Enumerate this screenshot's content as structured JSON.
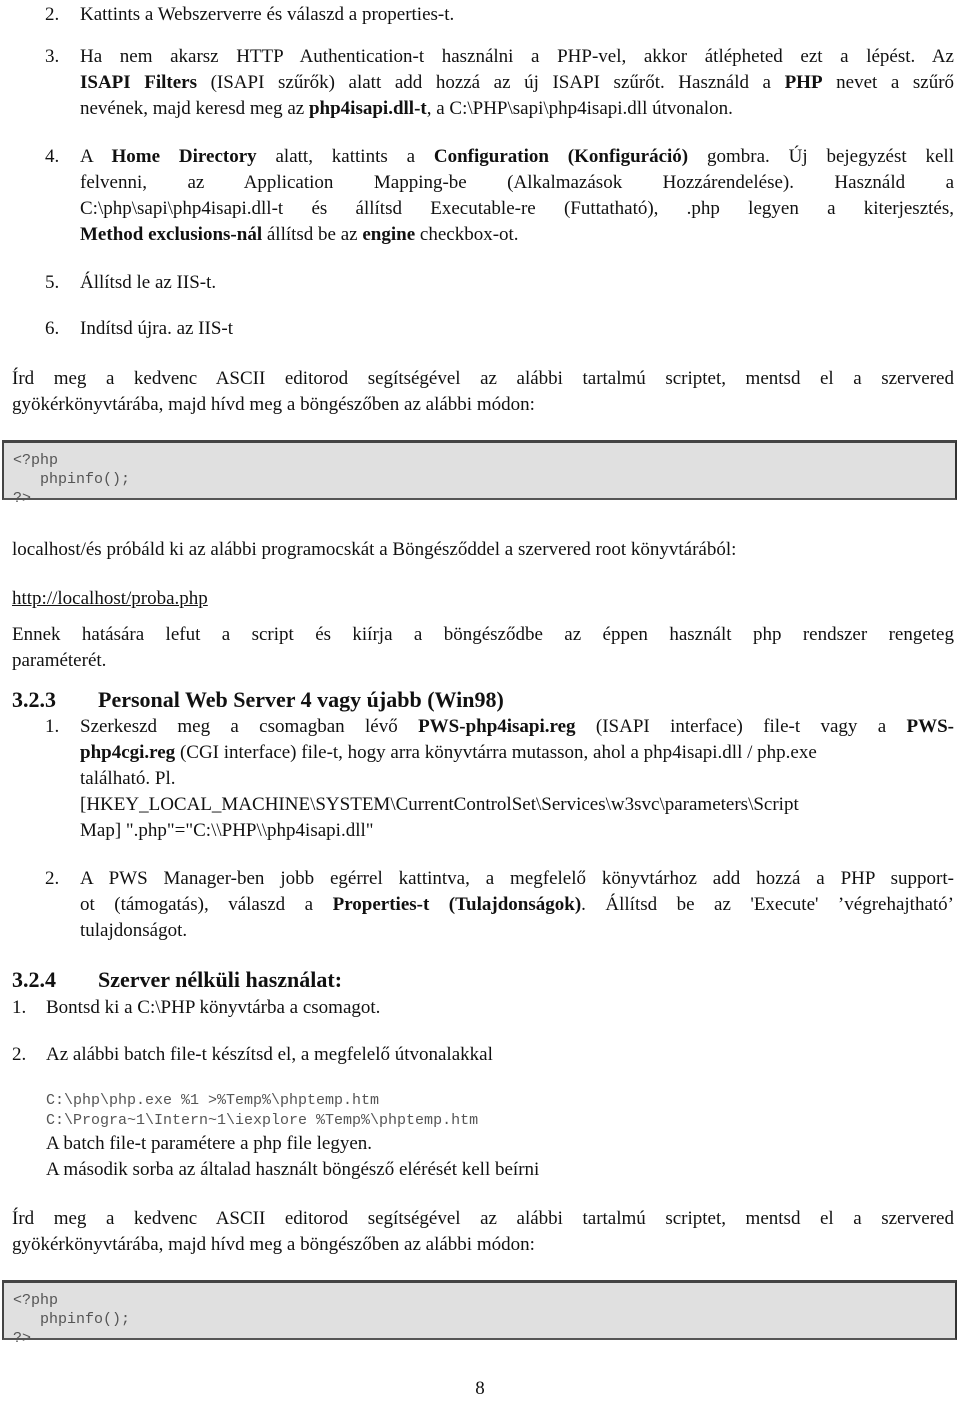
{
  "iis_steps": [
    {
      "num": "2.",
      "text": "Kattints a Webszerverre és válaszd a properties-t."
    },
    {
      "num": "3.",
      "lines": [
        "Ha nem akarsz HTTP Authentication-t használni a PHP-vel, akkor átléphet ezt a lépést. Az",
        "",
        ""
      ],
      "l1": "Ha nem akarsz HTTP Authentication-t használni a PHP-vel, akkor átlépheted ezt a lépést. Az",
      "l2_b1": "ISAPI Filters",
      "l2_t1": " (ISAPI szűrők) alatt add hozzá az új ISAPI szűrőt. Használd a ",
      "l2_b2": "PHP",
      "l2_t2": " nevet a szűrő",
      "l3_t1": "nevének, majd keresd meg az ",
      "l3_b1": "php4isapi.dll-t",
      "l3_t2": ", a C:\\PHP\\sapi\\php4isapi.dll útvonalon."
    },
    {
      "num": "4.",
      "l1_t1": "A ",
      "l1_b1": "Home Directory",
      "l1_t2": " alatt, kattints a ",
      "l1_b2": "Configuration (Konfiguráció)",
      "l1_t3": " gombra. Új bejegyzést kell",
      "l2": "felvenni, az Application Mapping-be (Alkalmazások Hozzárendelése). Használd a",
      "l3": "C:\\php\\sapi\\php4isapi.dll-t és állítsd Executable-re (Futtatható), .php legyen a kiterjesztés,",
      "l4_b1": "Method exclusions-nál",
      "l4_t1": " állítsd be az ",
      "l4_b2": "engine",
      "l4_t2": " checkbox-ot."
    },
    {
      "num": "5.",
      "text": "Állítsd le az IIS-t."
    },
    {
      "num": "6.",
      "text": "Indítsd újra. az IIS-t"
    }
  ],
  "intro1": {
    "l1": "Írd meg a kedvenc ASCII editorod segítségével az alábbi tartalmú scriptet, mentsd el a szervered",
    "l2": "gyökérkönyvtárába, majd hívd meg a böngészőben az alábbi módon:"
  },
  "code1": "<?php\n   phpinfo();\n?>",
  "localhost_text": "localhost/és próbáld ki az alábbi programocskát a Böngésződdel a szervered root könyvtárából:",
  "url_link": "http://localhost/proba.php",
  "effect": {
    "l1": "Ennek hatására lefut a script és kiírja a böngésződbe az éppen használt php rendszer rengeteg",
    "l2": "paraméterét."
  },
  "section_323": {
    "number": "3.2.3",
    "title": "Personal Web Server 4 vagy újabb (Win98)"
  },
  "pws_steps": [
    {
      "num": "1.",
      "l1_t1": "Szerkeszd meg a csomagban lévő ",
      "l1_b1": "PWS-php4isapi.reg",
      "l1_t2": " (ISAPI interface) file-t vagy a ",
      "l1_b2": "PWS-",
      "l2_b1": "php4cgi.reg",
      "l2_t1": " (CGI interface) file-t, hogy arra könyvtárra mutasson, ahol a php4isapi.dll / php.exe",
      "l3": "található. Pl.",
      "l4": "[HKEY_LOCAL_MACHINE\\SYSTEM\\CurrentControlSet\\Services\\w3svc\\parameters\\Script",
      "l5": "Map] \".php\"=\"C:\\\\PHP\\\\php4isapi.dll\""
    },
    {
      "num": "2.",
      "l1": "A PWS Manager-ben jobb egérrel kattintva, a megfelelő könyvtárhoz add hozzá a PHP support-",
      "l2_t1": "ot (támogatás), válaszd a  ",
      "l2_b1": "Properties-t (Tulajdonságok)",
      "l2_t2": ". Állítsd be az 'Execute' ’végrehajtható’",
      "l3": "tulajdonságot."
    }
  ],
  "section_324": {
    "number": "3.2.4",
    "title": "Szerver nélküli használat:"
  },
  "serverless_steps": [
    {
      "num": "1.",
      "text": "Bontsd ki a C:\\PHP könyvtárba a csomagot."
    },
    {
      "num": "2.",
      "text": "Az alábbi batch file-t készítsd el, a megfelelő útvonalakkal",
      "code_l1": "C:\\php\\php.exe %1 >%Temp%\\phptemp.htm",
      "code_l2": "C:\\Progra~1\\Intern~1\\iexplore %Temp%\\phptemp.htm",
      "note1": "A batch file-t paramétere a php file legyen.",
      "note2": "A második sorba az általad használt böngésző elérését kell beírni"
    }
  ],
  "intro2": {
    "l1": "Írd meg a kedvenc ASCII editorod segítségével az alábbi tartalmú scriptet, mentsd el a szervered",
    "l2": "gyökérkönyvtárába, majd hívd meg a böngészőben az alábbi módon:"
  },
  "code2": "<?php\n   phpinfo();\n?>",
  "page_number": "8"
}
